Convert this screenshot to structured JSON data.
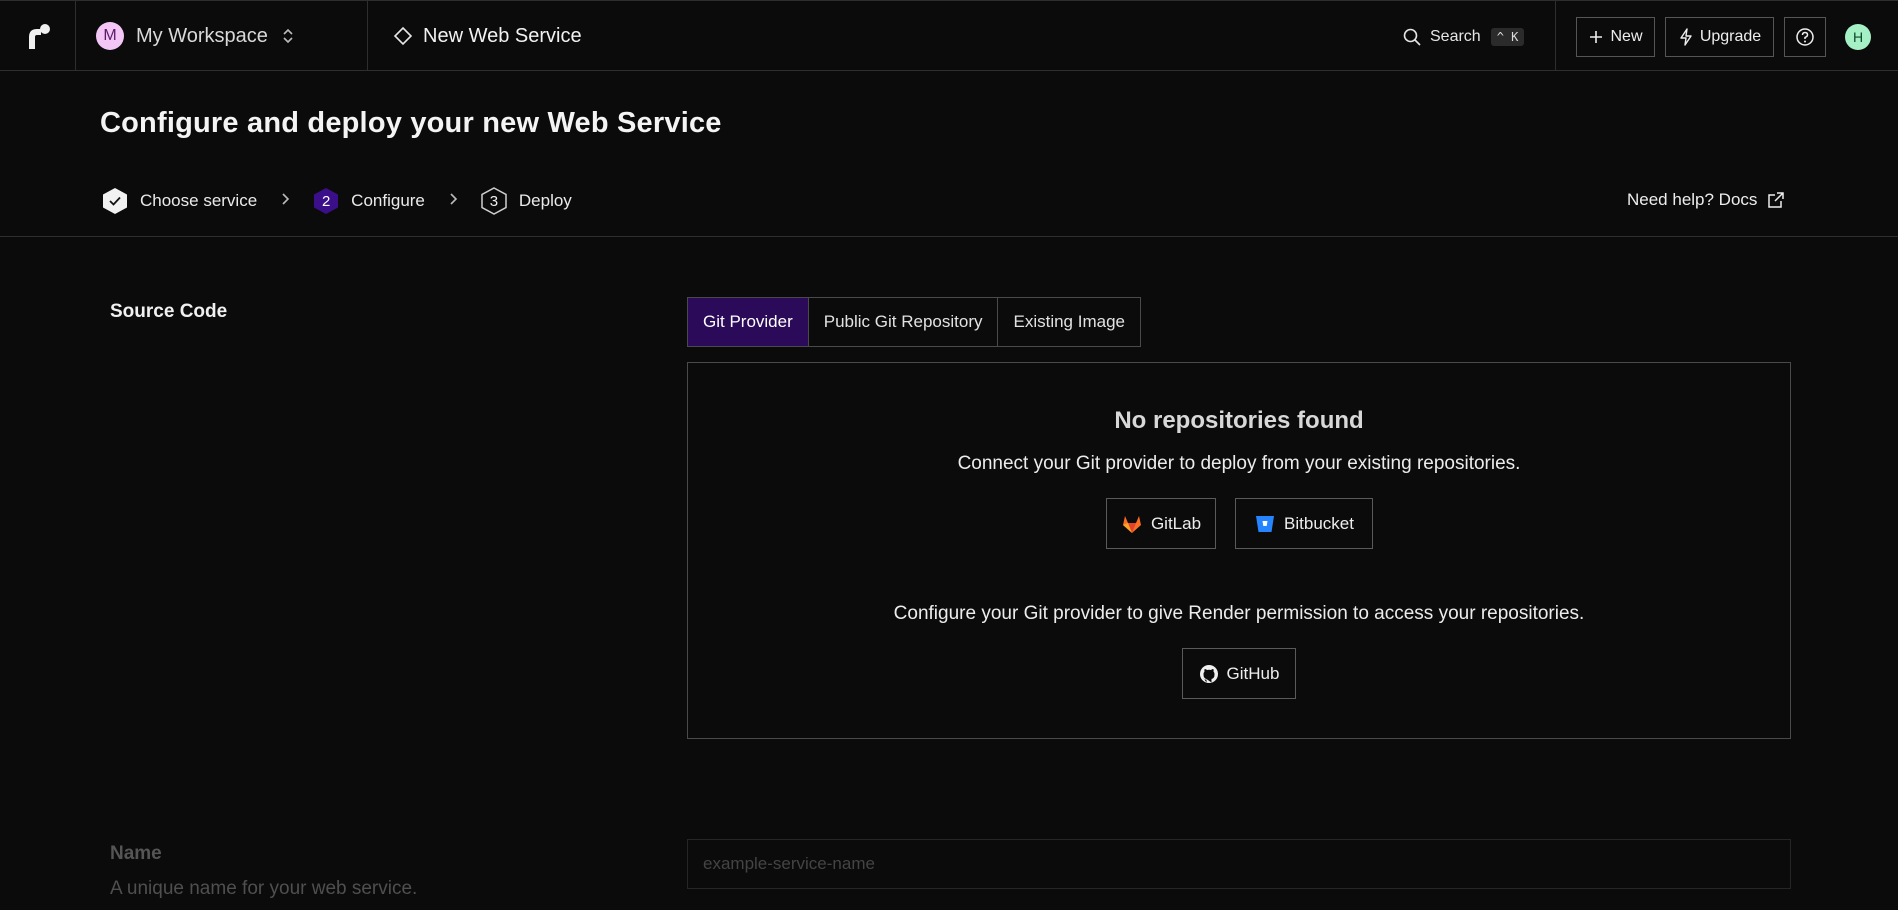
{
  "topbar": {
    "workspace": {
      "avatar_letter": "M",
      "name": "My Workspace"
    },
    "breadcrumb": {
      "label": "New Web Service"
    },
    "search": {
      "label": "Search",
      "shortcut": "^ K"
    },
    "buttons": {
      "new_label": "New",
      "upgrade_label": "Upgrade"
    },
    "user": {
      "avatar_letter": "H"
    }
  },
  "header": {
    "title": "Configure and deploy your new Web Service",
    "steps": [
      {
        "number": "",
        "label": "Choose service",
        "state": "done"
      },
      {
        "number": "2",
        "label": "Configure",
        "state": "current"
      },
      {
        "number": "3",
        "label": "Deploy",
        "state": "upcoming"
      }
    ],
    "help_link": "Need help? Docs"
  },
  "source_code": {
    "label": "Source Code",
    "tabs": [
      {
        "label": "Git Provider",
        "active": true
      },
      {
        "label": "Public Git Repository",
        "active": false
      },
      {
        "label": "Existing Image",
        "active": false
      }
    ],
    "panel": {
      "title": "No repositories found",
      "subtitle": "Connect your Git provider to deploy from your existing repositories.",
      "providers": [
        {
          "label": "GitLab",
          "icon": "gitlab-icon"
        },
        {
          "label": "Bitbucket",
          "icon": "bitbucket-icon"
        }
      ],
      "subtitle2": "Configure your Git provider to give Render permission to access your repositories.",
      "github": {
        "label": "GitHub",
        "icon": "github-icon"
      }
    }
  },
  "name_section": {
    "label": "Name",
    "description": "A unique name for your web service.",
    "placeholder": "example-service-name",
    "value": ""
  },
  "colors": {
    "background": "#0b0b0b",
    "active_tab": "#2b0b59",
    "step_current": "#3b0f8a",
    "workspace_avatar": "#f3c6f5",
    "user_avatar": "#a6f0c6",
    "gitlab": "#fc6d26",
    "bitbucket": "#2684ff"
  }
}
